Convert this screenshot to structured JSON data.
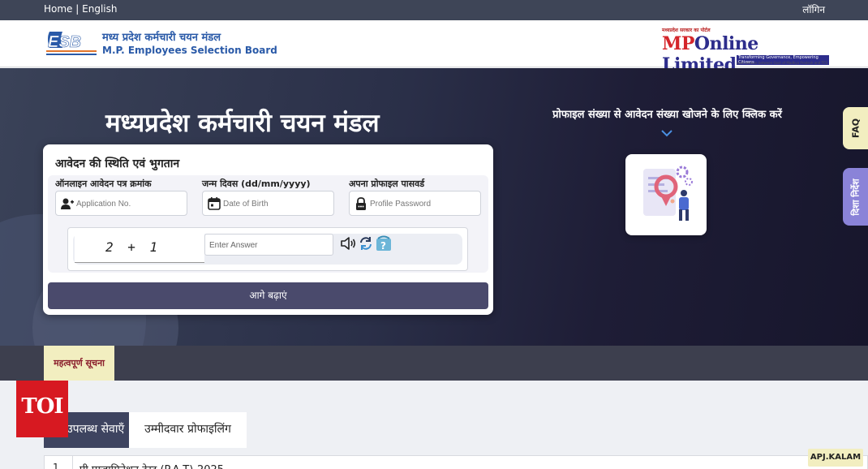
{
  "topbar": {
    "home": "Home",
    "separator": "|",
    "language": "English",
    "login": "लॉगिन"
  },
  "header": {
    "esb_title_hi": "मध्य प्रदेश कर्मचारी चयन मंडल",
    "esb_title_en": "M.P. Employees Selection Board",
    "mponline_tag": "मध्यप्रदेश सरकार का पोर्टल",
    "mponline_brand_mp": "MP",
    "mponline_brand_rest": "Online Limited",
    "mponline_tagline": "Transforming Governance, Empowering Citizens",
    "mponline_subline": "Joint venture between Govt of Madhya Pradesh and TCS"
  },
  "hero": {
    "title": "मध्यप्रदेश कर्मचारी चयन मंडल",
    "right_text": "प्रोफाइल संख्या से आवेदन संख्या खोजने के लिए क्लिक करें"
  },
  "form": {
    "title": "आवेदन की स्थिति एवं भुगतान",
    "fields": [
      {
        "label": "ऑनलाइन आवेदन पत्र क्रमांक",
        "placeholder": "Application No.",
        "icon": "add-user-icon"
      },
      {
        "label": "जन्म दिवस (dd/mm/yyyy)",
        "placeholder": "Date of Birth",
        "icon": "calendar-icon"
      },
      {
        "label": "अपना प्रोफाइल पासवर्ड",
        "placeholder": "Profile Password",
        "icon": "lock-icon"
      }
    ],
    "captcha_text": "2 + 1",
    "captcha_placeholder": "Enter Answer",
    "submit_label": "आगे बढ़ाएं"
  },
  "side_tabs": {
    "faq": "FAQ",
    "directions": "दिशा निर्देश"
  },
  "notice": {
    "label": "महत्वपूर्ण सूचना"
  },
  "tabs": [
    {
      "label": "उपलब्ध सेवाएँ",
      "active": true
    },
    {
      "label": "उम्मीदवार प्रोफाइलिंग",
      "active": false
    }
  ],
  "watermark": "TOI",
  "table": {
    "rows": [
      {
        "num": "1",
        "text": "प्री एग्जामिनेशन टेस्ट (P.A.T)-2025"
      }
    ]
  },
  "badge": "APJ.KALAM",
  "colors": {
    "topbar": "#3e4557",
    "hero_dark": "#17162c",
    "button": "#4a4a6c",
    "accent_yellow": "#f2eec0",
    "accent_purple": "#8a83d8",
    "toi_red": "#d71921"
  }
}
